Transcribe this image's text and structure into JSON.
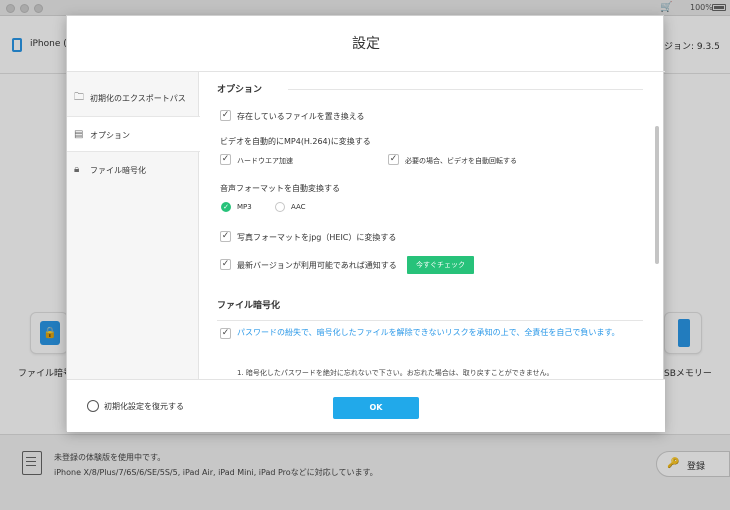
{
  "app": {
    "device_name": "iPhone (",
    "version_label": "ジョン: 9.3.5",
    "battery": "100%",
    "features": {
      "left_label": "ファイル暗号",
      "right_label": "SBメモリー"
    },
    "footer": {
      "line1": "未登録の体験版を使用中です。",
      "line2": "iPhone X/8/Plus/7/6S/6/SE/5S/5, iPad Air, iPad Mini, iPad Proなどに対応しています。",
      "register_label": "登録"
    }
  },
  "dialog": {
    "title": "設定",
    "sidebar": [
      {
        "label": "初期化のエクスポートパス",
        "icon": "folder-icon"
      },
      {
        "label": "オプション",
        "icon": "doc-options-icon"
      },
      {
        "label": "ファイル暗号化",
        "icon": "lock-icon"
      }
    ],
    "options": {
      "section_title": "オプション",
      "overwrite_files": "存在しているファイルを置き換える",
      "video_convert_heading": "ビデオを自動的にMP4(H.264)に変換する",
      "hardware_accel": "ハードウエア加速",
      "auto_rotate": "必要の場合、ビデオを自動回転する",
      "audio_heading": "音声フォーマットを自動変換する",
      "audio_mp3": "MP3",
      "audio_aac": "AAC",
      "photo_convert": "写真フォーマットをjpg（HEIC）に変換する",
      "notify_update": "最新バージョンが利用可能であれば通知する",
      "check_now": "今すぐチェック"
    },
    "encryption": {
      "section_title": "ファイル暗号化",
      "agreement": "パスワードの紛失で、暗号化したファイルを解除できないリスクを承知の上で、全責任を自己で負います。",
      "note1": "1. 暗号化したパスワードを絶対に忘れないで下さい。お忘れた場合は、取り戻すことができません。"
    },
    "footer": {
      "restore_label": "初期化設定を復元する",
      "ok_label": "OK"
    }
  },
  "colors": {
    "accent_blue": "#21a9ea",
    "accent_green": "#27c27a"
  }
}
